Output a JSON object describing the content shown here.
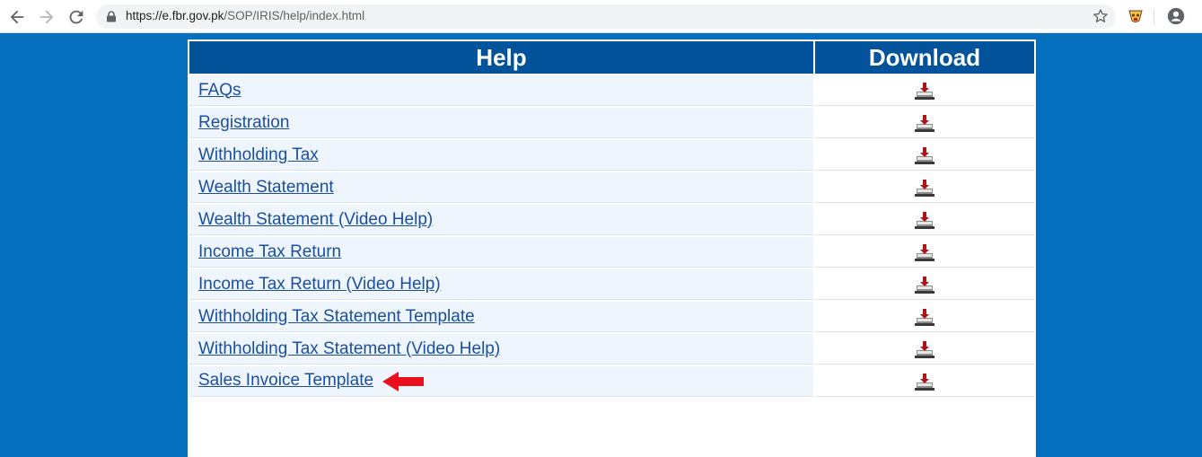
{
  "browser": {
    "url_scheme": "https://",
    "url_host": "e.fbr.gov.pk",
    "url_path": "/SOP/IRIS/help/index.html"
  },
  "table": {
    "header_help": "Help",
    "header_download": "Download",
    "rows": [
      {
        "label": "FAQs"
      },
      {
        "label": "Registration"
      },
      {
        "label": "Withholding Tax"
      },
      {
        "label": "Wealth Statement"
      },
      {
        "label": "Wealth Statement (Video Help)"
      },
      {
        "label": "Income Tax Return"
      },
      {
        "label": "Income Tax Return (Video Help)"
      },
      {
        "label": "Withholding Tax Statement Template"
      },
      {
        "label": "Withholding Tax Statement (Video Help)"
      },
      {
        "label": "Sales Invoice Template"
      }
    ]
  },
  "colors": {
    "page_bg": "#0470bd",
    "header_bg": "#02539a",
    "link": "#1b4f9d",
    "arrow": "#e8101c"
  },
  "icons": {
    "download": "download-tray-icon",
    "annotation": "red-arrow-left-icon"
  }
}
